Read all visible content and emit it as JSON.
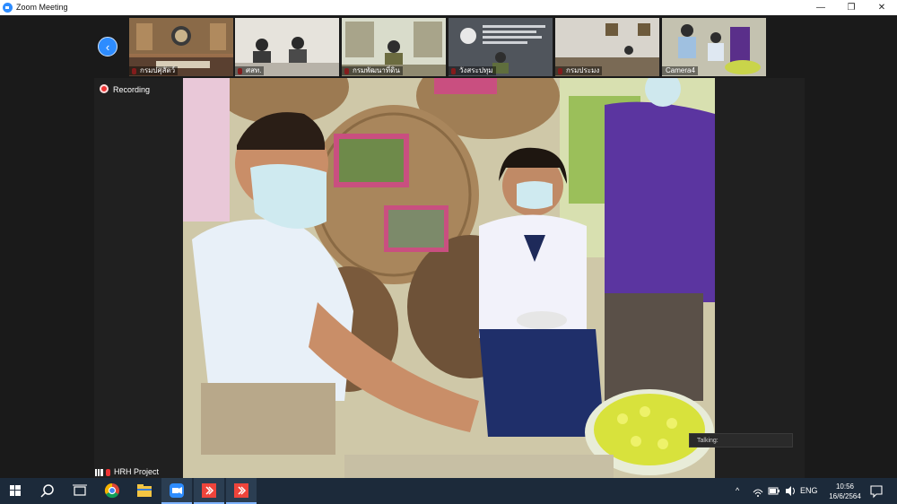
{
  "window": {
    "title": "Zoom Meeting",
    "minimize_glyph": "—",
    "restore_glyph": "❐",
    "close_glyph": "✕"
  },
  "gallery": {
    "back_glyph": "‹",
    "thumbnails": [
      {
        "label": "กรมปศุสัตว์"
      },
      {
        "label": "ศสท."
      },
      {
        "label": "กรมพัฒนาที่ดิน"
      },
      {
        "label": "วังสระปทุม"
      },
      {
        "label": "กรมประมง"
      },
      {
        "label": "Camera4"
      }
    ]
  },
  "main": {
    "recording_label": "Recording",
    "talking_label": "Talking:",
    "participant_name": "HRH Project"
  },
  "taskbar": {
    "tray_arrow": "^",
    "language": "ENG",
    "time": "10:56",
    "date": "16/6/2564"
  },
  "colors": {
    "zoom_blue": "#2d8cff",
    "taskbar": "#1c2a3a",
    "recording_red": "#e33333"
  }
}
